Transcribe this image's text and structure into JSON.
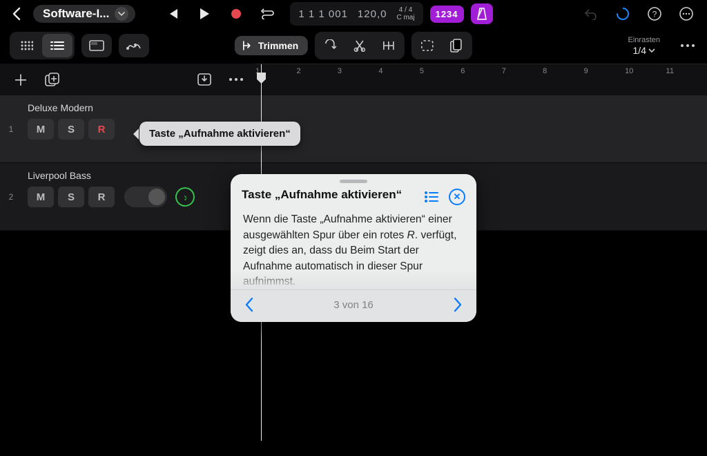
{
  "header": {
    "project_title": "Software-I...",
    "display": {
      "position": "1 1  1 001",
      "tempo": "120,0",
      "sig_top": "4 / 4",
      "sig_bottom": "C maj",
      "beats_icon": "1234"
    }
  },
  "toolbar": {
    "trim_label": "Trimmen",
    "snap": {
      "label": "Einrasten",
      "value": "1/4"
    }
  },
  "ruler": {
    "bars": [
      "1",
      "2",
      "3",
      "4",
      "5",
      "6",
      "7",
      "8",
      "9",
      "10",
      "11"
    ]
  },
  "tracks": [
    {
      "index": "1",
      "name": "Deluxe Modern",
      "m": "M",
      "s": "S",
      "r": "R",
      "selected": true,
      "rec_armed": true
    },
    {
      "index": "2",
      "name": "Liverpool Bass",
      "m": "M",
      "s": "S",
      "r": "R",
      "selected": false,
      "rec_armed": false
    }
  ],
  "tooltip": {
    "text": "Taste „Aufnahme aktivieren“"
  },
  "popover": {
    "title": "Taste „Aufnahme aktivieren“",
    "body_html": "Wenn die Taste „Aufnahme aktivieren“ einer ausgewählten Spur über ein rotes <em>R</em>. verfügt, zeigt dies an, dass du Beim Start der Aufnahme automatisch in dieser Spur aufnimmst.",
    "page": "3 von 16"
  }
}
